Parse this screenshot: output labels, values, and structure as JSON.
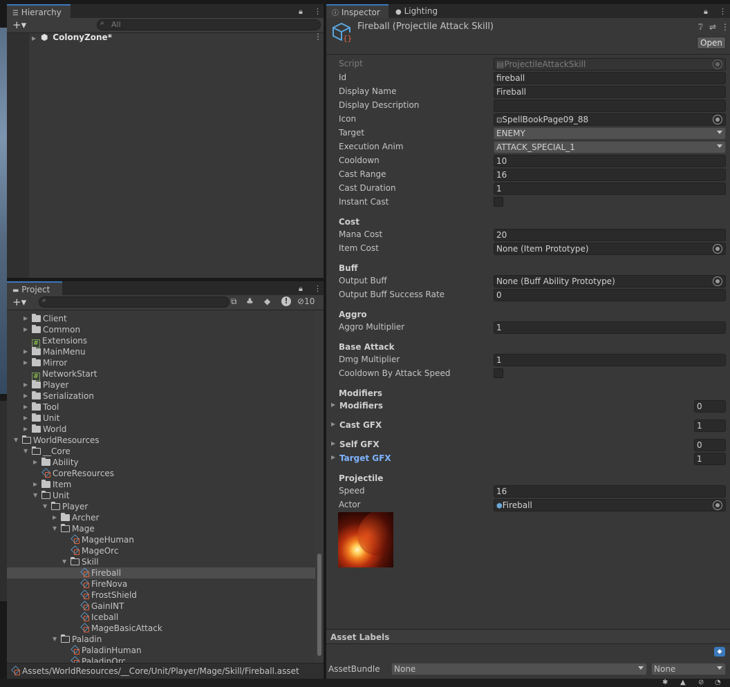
{
  "hierarchy": {
    "tab": "Hierarchy",
    "search_placeholder": "All",
    "scene": "ColonyZone*"
  },
  "project": {
    "tab": "Project",
    "hidden_count": "10",
    "tree": [
      {
        "label": "Client",
        "type": "folder",
        "depth": 0,
        "arrow": "right"
      },
      {
        "label": "Common",
        "type": "folder",
        "depth": 0,
        "arrow": "right"
      },
      {
        "label": "Extensions",
        "type": "script",
        "depth": 0,
        "arrow": ""
      },
      {
        "label": "MainMenu",
        "type": "folder",
        "depth": 0,
        "arrow": "right"
      },
      {
        "label": "Mirror",
        "type": "folder",
        "depth": 0,
        "arrow": "right"
      },
      {
        "label": "NetworkStart",
        "type": "script",
        "depth": 0,
        "arrow": ""
      },
      {
        "label": "Player",
        "type": "folder",
        "depth": 0,
        "arrow": "right"
      },
      {
        "label": "Serialization",
        "type": "folder",
        "depth": 0,
        "arrow": "right"
      },
      {
        "label": "Tool",
        "type": "folder",
        "depth": 0,
        "arrow": "right"
      },
      {
        "label": "Unit",
        "type": "folder",
        "depth": 0,
        "arrow": "right"
      },
      {
        "label": "World",
        "type": "folder",
        "depth": 0,
        "arrow": "right"
      },
      {
        "label": "WorldResources",
        "type": "folder-open",
        "depth": -1,
        "arrow": "down"
      },
      {
        "label": "__Core",
        "type": "folder-open",
        "depth": 0,
        "arrow": "down"
      },
      {
        "label": "Ability",
        "type": "folder",
        "depth": 1,
        "arrow": "right"
      },
      {
        "label": "CoreResources",
        "type": "so",
        "depth": 1,
        "arrow": ""
      },
      {
        "label": "Item",
        "type": "folder",
        "depth": 1,
        "arrow": "right"
      },
      {
        "label": "Unit",
        "type": "folder-open",
        "depth": 1,
        "arrow": "down"
      },
      {
        "label": "Player",
        "type": "folder-open",
        "depth": 2,
        "arrow": "down"
      },
      {
        "label": "Archer",
        "type": "folder",
        "depth": 3,
        "arrow": "right"
      },
      {
        "label": "Mage",
        "type": "folder-open",
        "depth": 3,
        "arrow": "down"
      },
      {
        "label": "MageHuman",
        "type": "so",
        "depth": 4,
        "arrow": ""
      },
      {
        "label": "MageOrc",
        "type": "so",
        "depth": 4,
        "arrow": ""
      },
      {
        "label": "Skill",
        "type": "folder-open",
        "depth": 4,
        "arrow": "down"
      },
      {
        "label": "Fireball",
        "type": "so",
        "depth": 5,
        "arrow": "",
        "selected": true
      },
      {
        "label": "FireNova",
        "type": "so",
        "depth": 5,
        "arrow": ""
      },
      {
        "label": "FrostShield",
        "type": "so",
        "depth": 5,
        "arrow": ""
      },
      {
        "label": "GainINT",
        "type": "so",
        "depth": 5,
        "arrow": ""
      },
      {
        "label": "Iceball",
        "type": "so",
        "depth": 5,
        "arrow": ""
      },
      {
        "label": "MageBasicAttack",
        "type": "so",
        "depth": 5,
        "arrow": ""
      },
      {
        "label": "Paladin",
        "type": "folder-open",
        "depth": 3,
        "arrow": "down"
      },
      {
        "label": "PaladinHuman",
        "type": "so",
        "depth": 4,
        "arrow": ""
      },
      {
        "label": "PaladinOrc",
        "type": "so",
        "depth": 4,
        "arrow": ""
      }
    ],
    "path": "Assets/WorldResources/__Core/Unit/Player/Mage/Skill/Fireball.asset"
  },
  "inspector": {
    "tab": "Inspector",
    "tab2": "Lighting",
    "title": "Fireball (Projectile Attack Skill)",
    "open_label": "Open",
    "fields": {
      "script": {
        "label": "Script",
        "value": "ProjectileAttackSkill"
      },
      "id": {
        "label": "Id",
        "value": "fireball"
      },
      "display_name": {
        "label": "Display Name",
        "value": "Fireball"
      },
      "display_description": {
        "label": "Display Description",
        "value": ""
      },
      "icon": {
        "label": "Icon",
        "value": "SpellBookPage09_88"
      },
      "target": {
        "label": "Target",
        "value": "ENEMY"
      },
      "execution_anim": {
        "label": "Execution Anim",
        "value": "ATTACK_SPECIAL_1"
      },
      "cooldown": {
        "label": "Cooldown",
        "value": "10"
      },
      "cast_range": {
        "label": "Cast Range",
        "value": "16"
      },
      "cast_duration": {
        "label": "Cast Duration",
        "value": "1"
      },
      "instant_cast": {
        "label": "Instant Cast",
        "checked": false
      },
      "cost_header": "Cost",
      "mana_cost": {
        "label": "Mana Cost",
        "value": "20"
      },
      "item_cost": {
        "label": "Item Cost",
        "value": "None (Item Prototype)"
      },
      "buff_header": "Buff",
      "output_buff": {
        "label": "Output Buff",
        "value": "None (Buff Ability Prototype)"
      },
      "output_buff_rate": {
        "label": "Output Buff Success Rate",
        "value": "0"
      },
      "aggro_header": "Aggro",
      "aggro_mult": {
        "label": "Aggro Multiplier",
        "value": "1"
      },
      "base_attack_header": "Base Attack",
      "dmg_mult": {
        "label": "Dmg Multiplier",
        "value": "1"
      },
      "cooldown_by_speed": {
        "label": "Cooldown By Attack Speed",
        "checked": false
      },
      "modifiers_header": "Modifiers",
      "modifiers": {
        "label": "Modifiers",
        "count": "0"
      },
      "cast_gfx": {
        "label": "Cast GFX",
        "count": "1"
      },
      "self_gfx": {
        "label": "Self GFX",
        "count": "0"
      },
      "target_gfx": {
        "label": "Target GFX",
        "count": "1"
      },
      "projectile_header": "Projectile",
      "speed": {
        "label": "Speed",
        "value": "16"
      },
      "actor": {
        "label": "Actor",
        "value": "Fireball"
      }
    },
    "asset_labels": "Asset Labels",
    "asset_bundle": {
      "label": "AssetBundle",
      "value": "None",
      "variant": "None"
    }
  },
  "colors": {
    "accent": "#3a79bb",
    "selected_row": "#4d4d4d",
    "panel": "#383838",
    "highlight_text": "#7fb3ff"
  }
}
